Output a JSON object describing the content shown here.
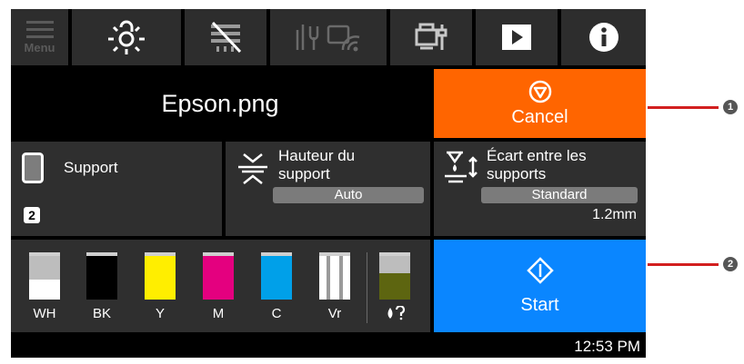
{
  "toolbar": {
    "menu_label": "Menu",
    "icons": [
      "menu-icon",
      "light-icon",
      "head-cleaning-icon",
      "network-icon",
      "maintenance-icon",
      "manual-icon",
      "info-icon"
    ]
  },
  "file": {
    "name": "Epson.png"
  },
  "cancel": {
    "label": "Cancel",
    "color": "#ff6500"
  },
  "media": {
    "label": "Support",
    "badge": "2"
  },
  "height": {
    "title_line1": "Hauteur du",
    "title_line2": "support",
    "value": "Auto"
  },
  "gap": {
    "title_line1": "Écart entre les",
    "title_line2": "supports",
    "value": "Standard",
    "measure": "1.2mm"
  },
  "inks": [
    {
      "label": "WH",
      "color": "#ffffff",
      "level": 0.45
    },
    {
      "label": "BK",
      "color": "#000000",
      "level": 1.0
    },
    {
      "label": "Y",
      "color": "#ffee00",
      "level": 1.0
    },
    {
      "label": "M",
      "color": "#e4007f",
      "level": 1.0
    },
    {
      "label": "C",
      "color": "#00a0e9",
      "level": 1.0
    },
    {
      "label": "Vr",
      "color": "#ffffff",
      "level": 1.0
    },
    {
      "label": "",
      "color": "#5d6510",
      "level": 0.6
    }
  ],
  "start": {
    "label": "Start",
    "color": "#0a86ff"
  },
  "status": {
    "time": "12:53 PM"
  },
  "callouts": [
    "1",
    "2"
  ]
}
